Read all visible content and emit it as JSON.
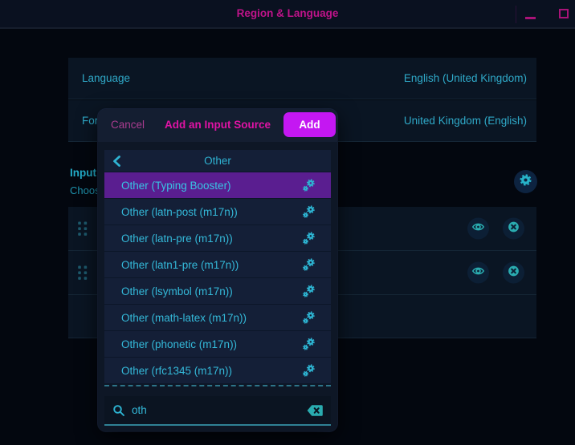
{
  "window": {
    "title": "Region & Language",
    "controls": [
      {
        "name": "minimize"
      },
      {
        "name": "maximize"
      }
    ]
  },
  "settings": {
    "rows": [
      {
        "label": "Language",
        "value": "English (United Kingdom)"
      },
      {
        "label": "For",
        "value": "United Kingdom (English)"
      }
    ],
    "input_section": {
      "heading": "Input",
      "subheading_visible": "Choos"
    },
    "source_rows_count": 3
  },
  "dialog": {
    "cancel_label": "Cancel",
    "title": "Add an Input Source",
    "add_label": "Add",
    "nav_title": "Other",
    "selected_index": 0,
    "items": [
      "Other (Typing Booster)",
      "Other (latn-post (m17n))",
      "Other (latn-pre (m17n))",
      "Other (latn1-pre (m17n))",
      "Other (lsymbol (m17n))",
      "Other (math-latex (m17n))",
      "Other (phonetic (m17n))",
      "Other (rfc1345 (m17n))"
    ],
    "search": {
      "value": "oth"
    }
  },
  "colors": {
    "accent_magenta": "#c0138a",
    "accent_teal": "#31b2d2",
    "selected_purple": "#5a1e90",
    "add_button": "#c417f2",
    "row_background": "#0a1523",
    "dialog_background": "#0e1726"
  }
}
